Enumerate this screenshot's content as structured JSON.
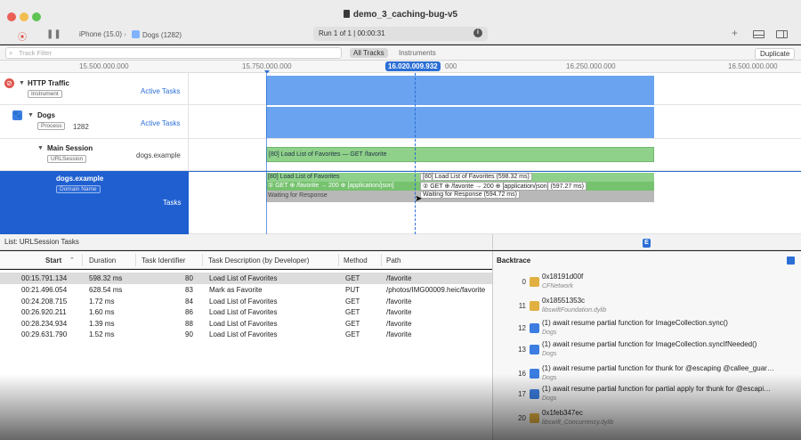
{
  "window": {
    "title": "demo_3_caching-bug-v5"
  },
  "toolbar": {
    "device": "iPhone (15.0)",
    "target": "Dogs (1282)",
    "run_info": "Run 1 of 1  |  00:00:31"
  },
  "filter": {
    "placeholder": "Track Filter",
    "all_tracks": "All Tracks",
    "instruments": "Instruments",
    "duplicate": "Duplicate"
  },
  "ruler": {
    "ticks": [
      "15.500.000.000",
      "15.750.000.000",
      "000",
      "16.250.000.000",
      "16.500.000.000"
    ],
    "cursor": "16.020.009.932"
  },
  "tracks": [
    {
      "name": "HTTP Traffic",
      "tag": "Instrument",
      "link": "Active Tasks"
    },
    {
      "name": "Dogs",
      "tag": "Process",
      "extra": "1282",
      "link": "Active Tasks"
    },
    {
      "name": "Main Session",
      "tag": "URLSession",
      "info": "dogs.example"
    },
    {
      "name": "dogs.example",
      "tag": "Domain Name",
      "info": "Tasks"
    }
  ],
  "timeline": {
    "main_session_bar": "[80] Load List of Favorites — GET /favorite",
    "domain_bar_1": "[80] Load List of Favorites",
    "domain_bar_2": "② GET ⊕ /favorite → 200 ⊕ [application/json]",
    "domain_bar_3": "Waiting for Response",
    "tip_1": "[80] Load List of Favorites (598.32 ms)",
    "tip_2": "② GET ⊕ /favorite → 200 ⊕ [application/json] (597.27 ms)",
    "tip_3": "Waiting for Response (594.72 ms)"
  },
  "list": {
    "title": "List: URLSession Tasks",
    "columns": [
      "Start",
      "Duration",
      "Task Identifier",
      "Task Description (by Developer)",
      "Method",
      "Path"
    ],
    "rows": [
      [
        "00:15.791.134",
        "598.32 ms",
        "80",
        "Load List of Favorites",
        "GET",
        "/favorite"
      ],
      [
        "00:21.496.054",
        "628.54 ms",
        "83",
        "Mark as Favorite",
        "PUT",
        "/photos/IMG00009.heic/favorite"
      ],
      [
        "00:24.208.715",
        "1.72 ms",
        "84",
        "Load List of Favorites",
        "GET",
        "/favorite"
      ],
      [
        "00:26.920.211",
        "1.60 ms",
        "86",
        "Load List of Favorites",
        "GET",
        "/favorite"
      ],
      [
        "00:28.234.934",
        "1.39 ms",
        "88",
        "Load List of Favorites",
        "GET",
        "/favorite"
      ],
      [
        "00:29.631.790",
        "1.52 ms",
        "90",
        "Load List of Favorites",
        "GET",
        "/favorite"
      ]
    ]
  },
  "backtrace": {
    "title": "Backtrace",
    "frames": [
      {
        "num": "0",
        "fn": "0x18191d00f",
        "lib": "CFNetwork",
        "icon_color": "#e0b040"
      },
      {
        "num": "11",
        "fn": "0x18551353c",
        "lib": "libswiftFoundation.dylib",
        "icon_color": "#e0b040"
      },
      {
        "num": "12",
        "fn": "(1) await resume partial function for ImageCollection.sync()",
        "lib": "Dogs",
        "icon_color": "#3b7de0"
      },
      {
        "num": "13",
        "fn": "(1) await resume partial function for ImageCollection.syncIfNeeded()",
        "lib": "Dogs",
        "icon_color": "#3b7de0"
      },
      {
        "num": "16",
        "fn": "(1) await resume partial function for thunk for @escaping @callee_guar…",
        "lib": "Dogs",
        "icon_color": "#3b7de0"
      },
      {
        "num": "17",
        "fn": "(1) await resume partial function for partial apply for thunk for @escapi…",
        "lib": "Dogs",
        "icon_color": "#3b7de0"
      },
      {
        "num": "20",
        "fn": "0x1feb347ec",
        "lib": "libswift_Concurrency.dylib",
        "icon_color": "#e0b040"
      }
    ]
  },
  "colors": {
    "accent": "#2b6fd6",
    "active_bar": "#6aa3ef",
    "green_bar": "#8fd18a",
    "gray_bar": "#b8b8b8",
    "selection": "#1f5fd0"
  }
}
